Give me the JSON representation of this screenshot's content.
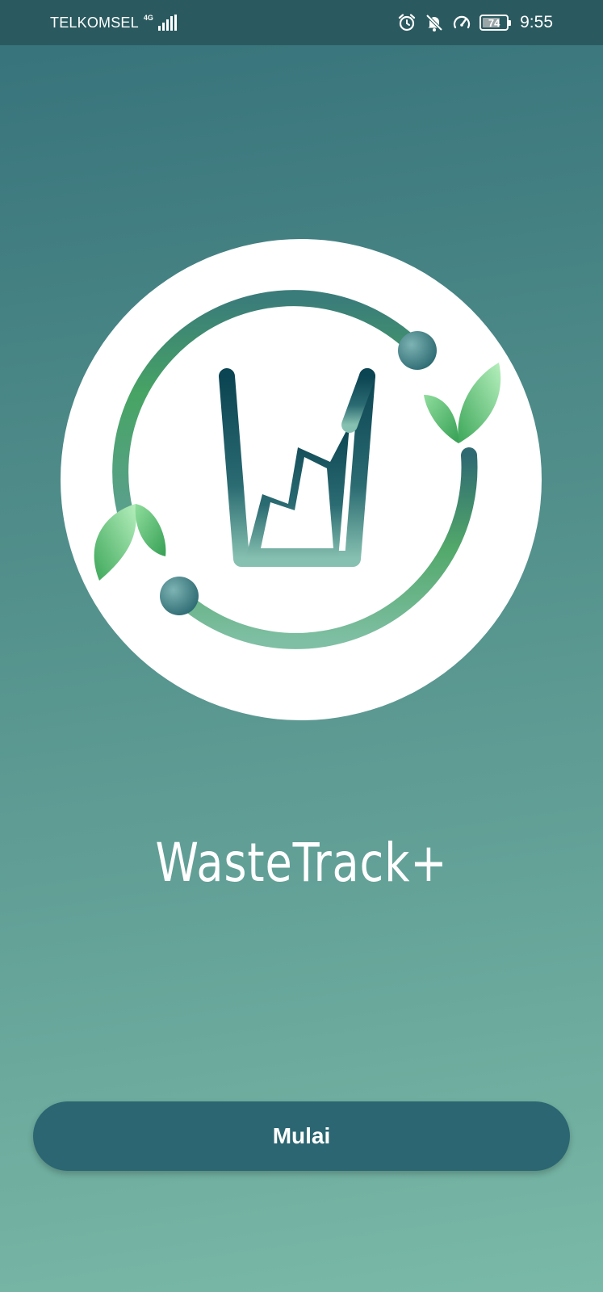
{
  "status_bar": {
    "carrier": "TELKOMSEL",
    "network_type": "4G",
    "battery_level": "74",
    "battery_fraction": 0.74,
    "time": "9:55",
    "icons": [
      "signal-icon",
      "alarm-icon",
      "bell-off-icon",
      "speedometer-icon",
      "battery-icon"
    ]
  },
  "app": {
    "name": "WasteTrack+",
    "logo": "wastetrack-logo"
  },
  "actions": {
    "start_label": "Mulai"
  },
  "colors": {
    "background_top": "#35717a",
    "background_bottom": "#7ab9a7",
    "status_bar": "#2a5a60",
    "button": "#2b6672",
    "logo_dark": "#0e4a57",
    "logo_green": "#4caf63",
    "logo_light_green": "#a8e6b0"
  }
}
